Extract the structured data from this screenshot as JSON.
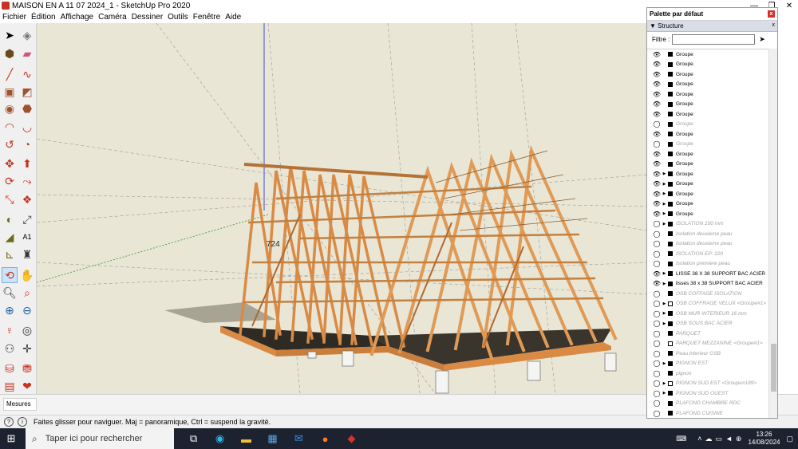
{
  "window": {
    "title": "MAISON EN  A 11 07 2024_1 - SketchUp Pro 2020",
    "controls": [
      "—",
      "❐",
      "✕"
    ]
  },
  "menu": [
    "Fichier",
    "Édition",
    "Affichage",
    "Caméra",
    "Dessiner",
    "Outils",
    "Fenêtre",
    "Aide"
  ],
  "viewport": {
    "dimension_label": "724"
  },
  "measurements": {
    "label": "Mesures"
  },
  "status": {
    "message": "Faites glisser pour naviguer. Maj = panoramique, Ctrl =  suspend la gravité."
  },
  "tray": {
    "title": "Palette par défaut",
    "close": "x",
    "section": "▼ Structure",
    "section_close": "x",
    "filter_label": "Filtre :",
    "filter_value": "",
    "items": [
      {
        "name": "Groupe",
        "visible": true,
        "expand": false,
        "type": "group"
      },
      {
        "name": "Groupe",
        "visible": true,
        "expand": false,
        "type": "group"
      },
      {
        "name": "Groupe",
        "visible": true,
        "expand": false,
        "type": "group"
      },
      {
        "name": "Groupe",
        "visible": true,
        "expand": false,
        "type": "group"
      },
      {
        "name": "Groupe",
        "visible": true,
        "expand": false,
        "type": "group"
      },
      {
        "name": "Groupe",
        "visible": true,
        "expand": false,
        "type": "group"
      },
      {
        "name": "Groupe",
        "visible": true,
        "expand": false,
        "type": "group"
      },
      {
        "name": "Groupe",
        "visible": false,
        "expand": false,
        "type": "group"
      },
      {
        "name": "Groupe",
        "visible": true,
        "expand": false,
        "type": "group"
      },
      {
        "name": "Groupe",
        "visible": false,
        "expand": false,
        "type": "group"
      },
      {
        "name": "Groupe",
        "visible": true,
        "expand": false,
        "type": "group"
      },
      {
        "name": "Groupe",
        "visible": true,
        "expand": false,
        "type": "group"
      },
      {
        "name": "Groupe",
        "visible": true,
        "expand": true,
        "type": "group"
      },
      {
        "name": "Groupe",
        "visible": true,
        "expand": true,
        "type": "group"
      },
      {
        "name": "Groupe",
        "visible": true,
        "expand": true,
        "type": "group"
      },
      {
        "name": "Groupe",
        "visible": true,
        "expand": true,
        "type": "group"
      },
      {
        "name": "Groupe",
        "visible": true,
        "expand": true,
        "type": "group"
      },
      {
        "name": "ISOLATION 100 mm",
        "visible": false,
        "expand": true,
        "type": "group"
      },
      {
        "name": "Isolation deuxieme peau",
        "visible": false,
        "expand": false,
        "type": "group"
      },
      {
        "name": "Isolation deuxieme peau",
        "visible": false,
        "expand": false,
        "type": "group"
      },
      {
        "name": "ISOLATION EP: 220",
        "visible": false,
        "expand": false,
        "type": "group"
      },
      {
        "name": "Isolation premiere peau",
        "visible": false,
        "expand": false,
        "type": "group"
      },
      {
        "name": "LISSE 38 X 38 SUPPORT BAC ACIER",
        "visible": true,
        "expand": true,
        "type": "group"
      },
      {
        "name": "lisses 38 x 38 SUPPORT BAC ACIER",
        "visible": true,
        "expand": true,
        "type": "group"
      },
      {
        "name": "OSB COFFAGE ISOLATION",
        "visible": false,
        "expand": false,
        "type": "group"
      },
      {
        "name": "OSB COFFRAGE VELUX <Groupe#1>",
        "visible": false,
        "expand": true,
        "type": "comp"
      },
      {
        "name": "OSB MUR INTERIEUR 16 mm",
        "visible": false,
        "expand": true,
        "type": "group"
      },
      {
        "name": "OSB SOUS BAC ACIER",
        "visible": false,
        "expand": true,
        "type": "group"
      },
      {
        "name": "PARQUET",
        "visible": false,
        "expand": false,
        "type": "group"
      },
      {
        "name": "PARQUET MEZZANINE <Groupe#1>",
        "visible": false,
        "expand": false,
        "type": "comp"
      },
      {
        "name": "Peau interieur OSB",
        "visible": false,
        "expand": false,
        "type": "group"
      },
      {
        "name": "PIGNON EST",
        "visible": false,
        "expand": true,
        "type": "group"
      },
      {
        "name": "pignon",
        "visible": false,
        "expand": false,
        "type": "group"
      },
      {
        "name": "PIGNON SUD EST <Groupe#189>",
        "visible": false,
        "expand": true,
        "type": "comp"
      },
      {
        "name": "PIGNON SUD OUEST",
        "visible": false,
        "expand": true,
        "type": "group"
      },
      {
        "name": "PLAFOND CHAMBRE RDC",
        "visible": false,
        "expand": false,
        "type": "group"
      },
      {
        "name": "PLAFOND CUISINE",
        "visible": false,
        "expand": false,
        "type": "group"
      }
    ]
  },
  "taskbar": {
    "search_placeholder": "Taper ici pour rechercher",
    "time": "13:26",
    "date": "14/08/2024"
  },
  "colors": {
    "viewport_bg": "#e9e6d6",
    "wood": "#d98b45",
    "taskbar": "#1c2230"
  }
}
